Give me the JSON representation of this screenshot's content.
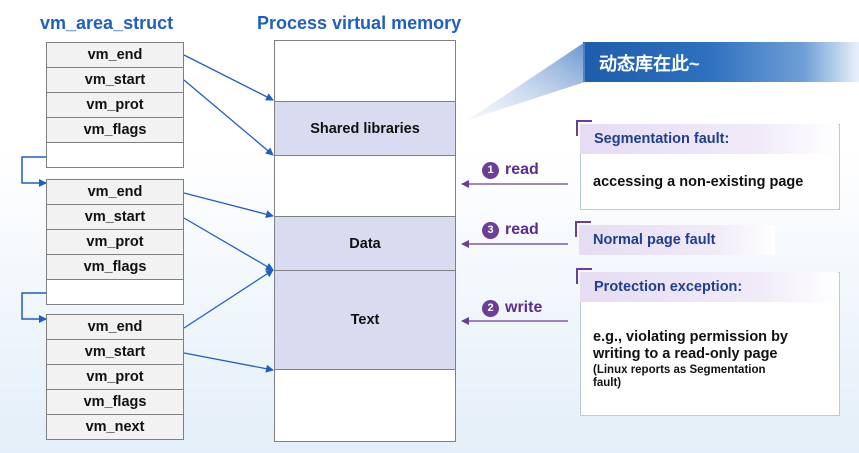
{
  "headings": {
    "vma": "vm_area_struct",
    "memory": "Process virtual memory"
  },
  "vma_blocks": [
    {
      "rows": [
        "vm_end",
        "vm_start",
        "vm_prot",
        "vm_flags",
        ""
      ]
    },
    {
      "rows": [
        "vm_end",
        "vm_start",
        "vm_prot",
        "vm_flags",
        ""
      ]
    },
    {
      "rows": [
        "vm_end",
        "vm_start",
        "vm_prot",
        "vm_flags",
        "vm_next"
      ]
    }
  ],
  "regions": {
    "shared": "Shared libraries",
    "data": "Data",
    "text": "Text"
  },
  "banner": "动态库在此~",
  "operations": [
    {
      "num": "1",
      "label": "read"
    },
    {
      "num": "3",
      "label": "read"
    },
    {
      "num": "2",
      "label": "write"
    }
  ],
  "callouts": {
    "segfault": {
      "title": "Segmentation fault:",
      "text": "accessing a non-existing page"
    },
    "normal": {
      "title": "Normal page fault"
    },
    "protection": {
      "title": "Protection exception:",
      "text_line1": "e.g., violating permission by",
      "text_line2": "writing to a read-only page",
      "note_line1": "(Linux reports as Segmentation",
      "note_line2": "fault)"
    }
  },
  "colors": {
    "heading": "#1f5fc4",
    "arrow": "#1f5fc4",
    "op": "#5c2d91",
    "region": "#d9dcf0",
    "banner": "#1d5dab"
  }
}
